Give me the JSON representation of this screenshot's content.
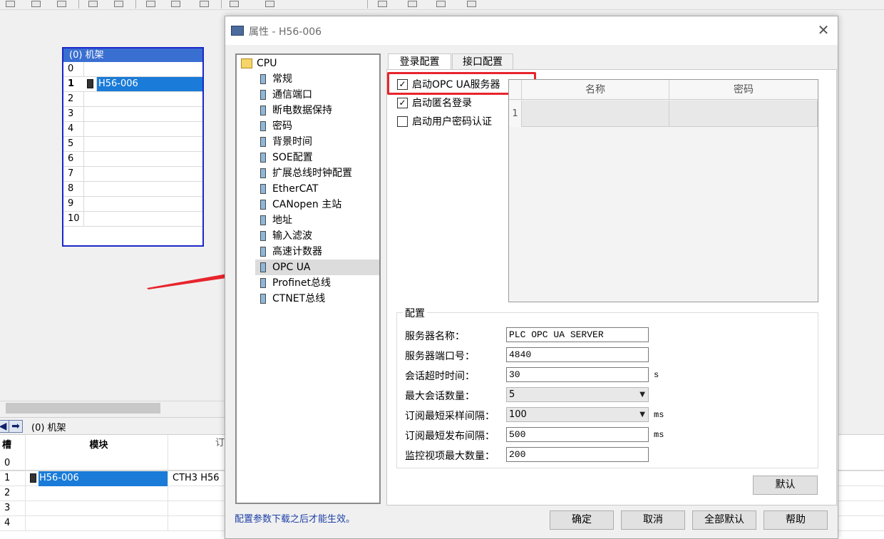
{
  "rack": {
    "title": "(0)  机架",
    "rows": [
      "0",
      "1",
      "2",
      "3",
      "4",
      "5",
      "6",
      "7",
      "8",
      "9",
      "10"
    ],
    "module": "H56-006"
  },
  "bottom": {
    "title": "(0)  机架",
    "headers": {
      "slot": "槽",
      "module": "模块",
      "partial": "订"
    },
    "rows": [
      "0",
      "1",
      "2",
      "3",
      "4"
    ],
    "module": "H56-006",
    "order": "CTH3 H56"
  },
  "dialog": {
    "title": "属性 - H56-006",
    "tree": {
      "root": "CPU",
      "items": [
        "常规",
        "通信端口",
        "断电数据保持",
        "密码",
        "背景时间",
        "SOE配置",
        "扩展总线时钟配置",
        "EtherCAT",
        "CANopen 主站",
        "地址",
        "输入滤波",
        "高速计数器",
        "OPC UA",
        "Profinet总线",
        "CTNET总线"
      ],
      "selected": "OPC UA"
    },
    "note": "配置参数下载之后才能生效。",
    "tabs": {
      "login": "登录配置",
      "interface": "接口配置"
    },
    "checkboxes": {
      "enable_server": {
        "label": "启动OPC UA服务器",
        "checked": true,
        "mark": "✓"
      },
      "enable_anonymous": {
        "label": "启动匿名登录",
        "checked": true,
        "mark": "✓"
      },
      "enable_userpass": {
        "label": "启动用户密码认证",
        "checked": false,
        "mark": ""
      }
    },
    "user_table": {
      "col_name": "名称",
      "col_password": "密码",
      "rows": [
        "1"
      ]
    },
    "config": {
      "group_title": "配置",
      "server_name_label": "服务器名称：",
      "server_name": "PLC OPC UA SERVER",
      "port_label": "服务器端口号：",
      "port": "4840",
      "timeout_label": "会话超时时间：",
      "timeout": "30",
      "timeout_unit": "s",
      "max_sessions_label": "最大会话数量：",
      "max_sessions": "5",
      "min_sample_label": "订阅最短采样间隔：",
      "min_sample": "100",
      "min_sample_unit": "ms",
      "min_publish_label": "订阅最短发布间隔：",
      "min_publish": "500",
      "min_publish_unit": "ms",
      "max_items_label": "监控视项最大数量：",
      "max_items": "200"
    },
    "buttons": {
      "default": "默认",
      "ok": "确定",
      "cancel": "取消",
      "all_default": "全部默认",
      "help": "帮助"
    },
    "colors": {
      "highlight": "#e8242c",
      "arrow": "#e8242c",
      "selection": "#1a7bd8"
    }
  }
}
